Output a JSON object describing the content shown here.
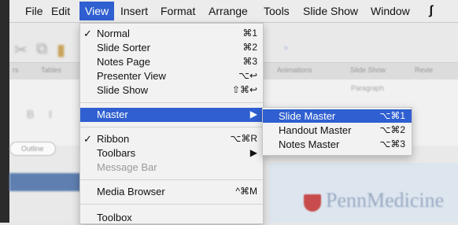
{
  "menubar": {
    "items": [
      "File",
      "Edit",
      "View",
      "Insert",
      "Format",
      "Arrange",
      "Tools",
      "Slide Show",
      "Window"
    ],
    "active": "View"
  },
  "background": {
    "ribbon_tabs": [
      "rs",
      "Tables",
      "Animations",
      "Slide Show",
      "Revie"
    ],
    "outline_label": "Outline",
    "paragraph_label": "Paragraph",
    "brand_text": "PennMedicine"
  },
  "view_menu": {
    "items": [
      {
        "label": "Normal",
        "checked": "✓",
        "shortcut": "⌘1"
      },
      {
        "label": "Slide Sorter",
        "checked": "",
        "shortcut": "⌘2"
      },
      {
        "label": "Notes Page",
        "checked": "",
        "shortcut": "⌘3"
      },
      {
        "label": "Presenter View",
        "checked": "",
        "shortcut": "⌥↩"
      },
      {
        "label": "Slide Show",
        "checked": "",
        "shortcut": "⇧⌘↩"
      },
      {
        "label": "Master",
        "checked": "",
        "shortcut": "▶"
      },
      {
        "label": "Ribbon",
        "checked": "✓",
        "shortcut": "⌥⌘R"
      },
      {
        "label": "Toolbars",
        "checked": "",
        "shortcut": "▶"
      },
      {
        "label": "Message Bar",
        "checked": "",
        "shortcut": ""
      },
      {
        "label": "Media Browser",
        "checked": "",
        "shortcut": "^⌘M"
      },
      {
        "label": "Toolbox",
        "checked": "",
        "shortcut": ""
      }
    ]
  },
  "master_submenu": {
    "items": [
      {
        "label": "Slide Master",
        "shortcut": "⌥⌘1"
      },
      {
        "label": "Handout Master",
        "shortcut": "⌥⌘2"
      },
      {
        "label": "Notes Master",
        "shortcut": "⌥⌘3"
      }
    ]
  },
  "colors": {
    "highlight": "#2f5fd0"
  }
}
